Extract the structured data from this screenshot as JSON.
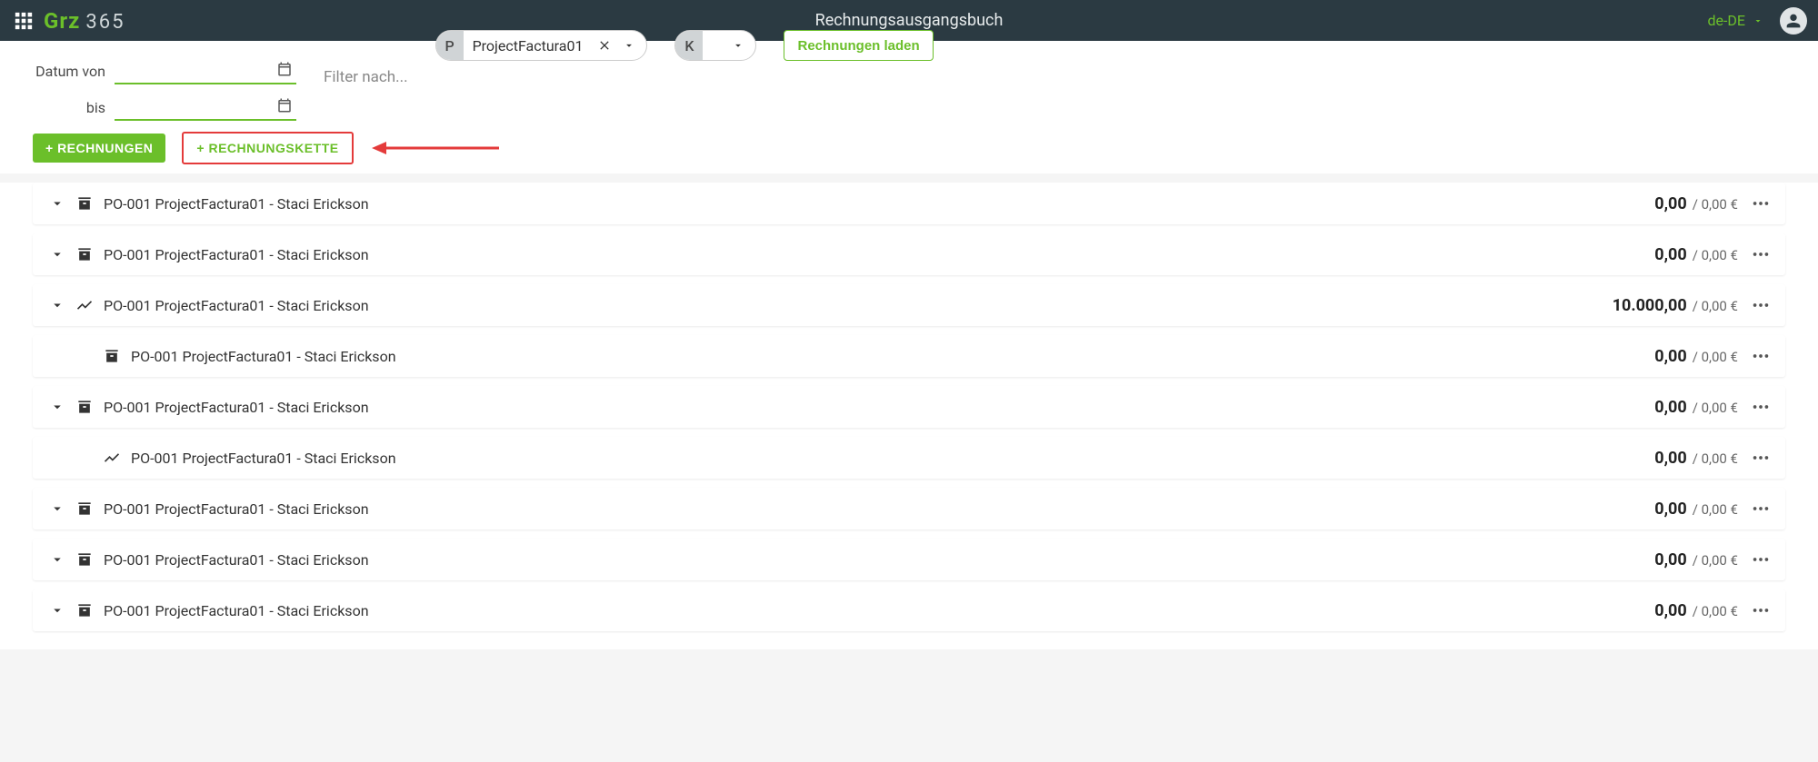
{
  "header": {
    "brand": "Grz",
    "brand_suffix": "365",
    "page_title": "Rechnungsausgangsbuch",
    "locale": "de-DE"
  },
  "filters": {
    "date_from_label": "Datum von",
    "date_to_label": "bis",
    "filter_label": "Filter nach...",
    "project_tag": "P",
    "project_value": "ProjectFactura01",
    "cost_tag": "K",
    "load_button": "Rechnungen laden"
  },
  "actions": {
    "add_invoices": "+ RECHNUNGEN",
    "add_chain": "+ RECHNUNGSKETTE"
  },
  "rows": [
    {
      "expand": true,
      "indent": false,
      "icon": "archive",
      "label": "PO-001 ProjectFactura01 - Staci Erickson",
      "main": "0,00",
      "sub": "/ 0,00 €"
    },
    {
      "expand": true,
      "indent": false,
      "icon": "archive",
      "label": "PO-001 ProjectFactura01 - Staci Erickson",
      "main": "0,00",
      "sub": "/ 0,00 €"
    },
    {
      "expand": true,
      "indent": false,
      "icon": "trend",
      "label": "PO-001 ProjectFactura01 - Staci Erickson",
      "main": "10.000,00",
      "sub": "/ 0,00 €"
    },
    {
      "expand": false,
      "indent": true,
      "icon": "archive",
      "label": "PO-001 ProjectFactura01 - Staci Erickson",
      "main": "0,00",
      "sub": "/ 0,00 €"
    },
    {
      "expand": true,
      "indent": false,
      "icon": "archive",
      "label": "PO-001 ProjectFactura01 - Staci Erickson",
      "main": "0,00",
      "sub": "/ 0,00 €"
    },
    {
      "expand": false,
      "indent": true,
      "icon": "trend",
      "label": "PO-001 ProjectFactura01 - Staci Erickson",
      "main": "0,00",
      "sub": "/ 0,00 €"
    },
    {
      "expand": true,
      "indent": false,
      "icon": "archive",
      "label": "PO-001 ProjectFactura01 - Staci Erickson",
      "main": "0,00",
      "sub": "/ 0,00 €"
    },
    {
      "expand": true,
      "indent": false,
      "icon": "archive",
      "label": "PO-001 ProjectFactura01 - Staci Erickson",
      "main": "0,00",
      "sub": "/ 0,00 €"
    },
    {
      "expand": true,
      "indent": false,
      "icon": "archive",
      "label": "PO-001 ProjectFactura01 - Staci Erickson",
      "main": "0,00",
      "sub": "/ 0,00 €"
    }
  ]
}
